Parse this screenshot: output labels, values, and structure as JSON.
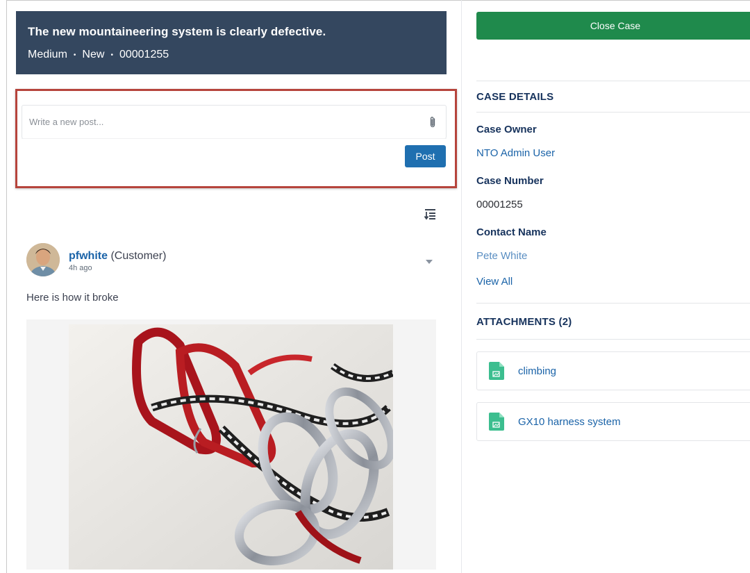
{
  "case": {
    "subject": "The new mountaineering system is clearly defective.",
    "priority": "Medium",
    "status": "New",
    "number": "00001255",
    "meta_separator": "•"
  },
  "publisher": {
    "placeholder": "Write a new post...",
    "post_label": "Post"
  },
  "feed": {
    "author_name": "pfwhite",
    "author_role": "(Customer)",
    "time_ago": "4h ago",
    "body": "Here is how it broke"
  },
  "actions": {
    "close_case_label": "Close Case"
  },
  "details": {
    "section_title": "CASE DETAILS",
    "case_owner_label": "Case Owner",
    "case_owner_value": "NTO Admin User",
    "case_number_label": "Case Number",
    "case_number_value": "00001255",
    "contact_name_label": "Contact Name",
    "contact_name_value": "Pete White",
    "view_all_label": "View All"
  },
  "attachments": {
    "section_title": "ATTACHMENTS (2)",
    "items": [
      {
        "name": "climbing"
      },
      {
        "name": "GX10 harness system"
      }
    ]
  },
  "colors": {
    "header_bg": "#34475f",
    "highlight_border": "#b6443c",
    "post_button": "#1f6fb0",
    "close_case_button": "#1f8a4c",
    "link": "#1a63a8",
    "file_icon": "#3cbe8f"
  }
}
